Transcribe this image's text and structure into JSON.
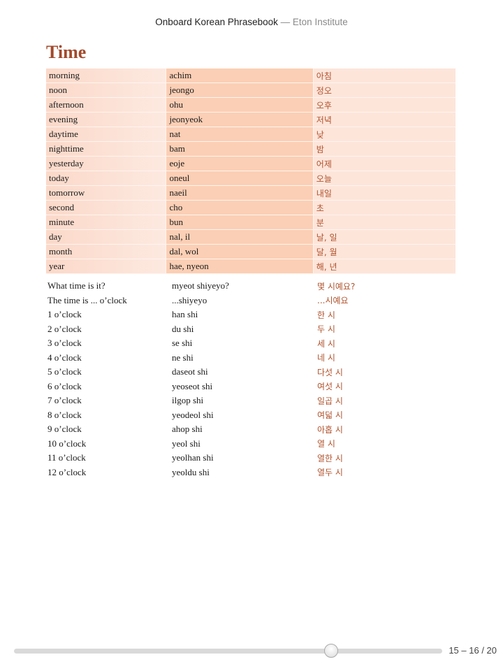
{
  "header": {
    "book_title": "Onboard Korean Phrasebook",
    "separator": "— ",
    "publisher": "Eton Institute"
  },
  "section_title": "Time",
  "vocab_table": [
    {
      "english": "morning",
      "romanization": "achim",
      "korean": "아침"
    },
    {
      "english": "noon",
      "romanization": "jeongo",
      "korean": "정오"
    },
    {
      "english": "afternoon",
      "romanization": "ohu",
      "korean": "오후"
    },
    {
      "english": "evening",
      "romanization": "jeonyeok",
      "korean": "저녁"
    },
    {
      "english": "daytime",
      "romanization": "nat",
      "korean": "낮"
    },
    {
      "english": "nighttime",
      "romanization": "bam",
      "korean": "밤"
    },
    {
      "english": "yesterday",
      "romanization": "eoje",
      "korean": "어제"
    },
    {
      "english": "today",
      "romanization": "oneul",
      "korean": "오늘"
    },
    {
      "english": "tomorrow",
      "romanization": "naeil",
      "korean": "내일"
    },
    {
      "english": "second",
      "romanization": "cho",
      "korean": "초"
    },
    {
      "english": "minute",
      "romanization": "bun",
      "korean": "분"
    },
    {
      "english": "day",
      "romanization": "nal, il",
      "korean": "날, 일"
    },
    {
      "english": "month",
      "romanization": "dal, wol",
      "korean": "달, 월"
    },
    {
      "english": "year",
      "romanization": "hae, nyeon",
      "korean": "해, 년"
    }
  ],
  "phrase_table": [
    {
      "english": "What time is it?",
      "romanization": "myeot shiyeyo?",
      "korean": "몇 시예요?"
    },
    {
      "english": "The time is ... o’clock",
      "romanization": "...shiyeyo",
      "korean": "...시예요"
    },
    {
      "english": "1 o’clock",
      "romanization": "han shi",
      "korean": "한 시"
    },
    {
      "english": "2 o’clock",
      "romanization": "du shi",
      "korean": "두 시"
    },
    {
      "english": "3 o’clock",
      "romanization": "se shi",
      "korean": "세 시"
    },
    {
      "english": "4 o’clock",
      "romanization": "ne shi",
      "korean": "네 시"
    },
    {
      "english": "5 o’clock",
      "romanization": "daseot shi",
      "korean": "다섯 시"
    },
    {
      "english": "6 o’clock",
      "romanization": "yeoseot shi",
      "korean": "여섯 시"
    },
    {
      "english": "7 o’clock",
      "romanization": "ilgop shi",
      "korean": "일곱 시"
    },
    {
      "english": "8 o’clock",
      "romanization": "yeodeol shi",
      "korean": "여덟 시"
    },
    {
      "english": "9 o’clock",
      "romanization": "ahop shi",
      "korean": "아홉 시"
    },
    {
      "english": "10 o’clock",
      "romanization": "yeol shi",
      "korean": "열 시"
    },
    {
      "english": "11 o’clock",
      "romanization": "yeolhan shi",
      "korean": "열한 시"
    },
    {
      "english": "12 o’clock",
      "romanization": "yeoldu shi",
      "korean": "열두 시"
    }
  ],
  "footer": {
    "page_indicator": "15 – 16 / 20",
    "slider_position_fraction": 0.74
  },
  "colors": {
    "accent": "#a2492b",
    "korean_text": "#b0532d",
    "row_bg_light": "#fde5da",
    "row_bg_mid": "#fbcfb5"
  }
}
